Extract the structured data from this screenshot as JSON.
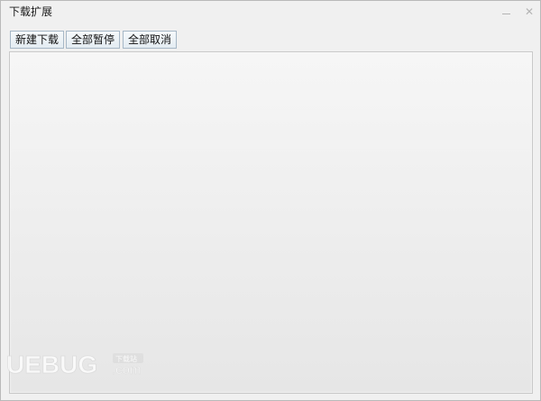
{
  "window": {
    "title": "下载扩展"
  },
  "toolbar": {
    "new_download": "新建下载",
    "pause_all": "全部暂停",
    "cancel_all": "全部取消"
  },
  "watermark": {
    "brand": "UEBUG",
    "suffix": ".com",
    "tag": "下载站"
  },
  "colors": {
    "button_border": "#a6b7c6",
    "panel_bg": "#eeeeee",
    "window_bg": "#f0f0f0"
  }
}
